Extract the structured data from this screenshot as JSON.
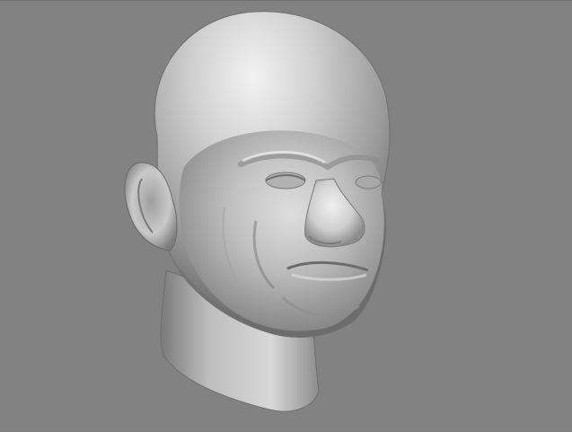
{
  "viewport": {
    "background_color": "#828282",
    "model_color": "#bdbdbd",
    "model_name": "head-sculpt",
    "shading": "smooth-grey"
  }
}
